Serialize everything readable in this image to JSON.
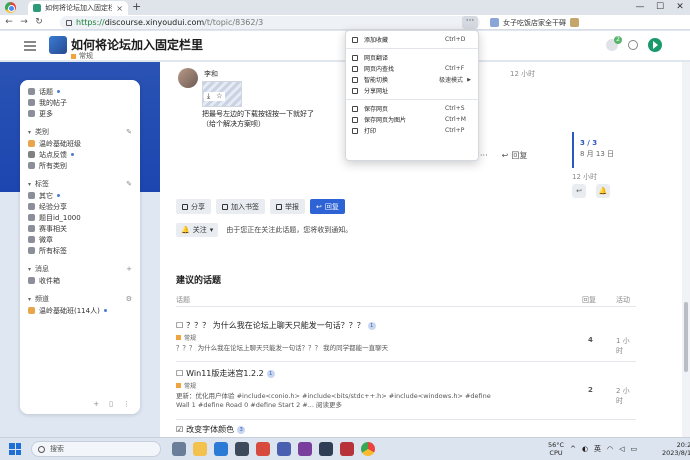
{
  "browser": {
    "tab_title": "如何将论坛加入固定栏里 - 智",
    "tab_close": "×",
    "new_tab": "+",
    "url_scheme": "https://",
    "url_host": "discourse.xinyoudui.com",
    "url_path": "/t/topic/8362/3",
    "more": "···",
    "ext_text": "女子吃饭店家全干碍",
    "win_min": "—",
    "win_max": "☐",
    "win_close": "✕",
    "star": "☆"
  },
  "header": {
    "title": "如何将论坛加入固定栏里",
    "category": "常规",
    "notification_count": "2"
  },
  "sidebar": {
    "top_items": [
      {
        "label": "话题"
      },
      {
        "label": "我的帖子"
      },
      {
        "label": "更多"
      }
    ],
    "categories_label": "类别",
    "categories": [
      {
        "label": "温岭基础班级"
      },
      {
        "label": "站点反馈"
      },
      {
        "label": "所有类别"
      }
    ],
    "tags_label": "标签",
    "tags": [
      {
        "label": "其它"
      },
      {
        "label": "经验分享"
      },
      {
        "label": "题目id_1000"
      },
      {
        "label": "赛事相关"
      },
      {
        "label": "微章"
      },
      {
        "label": "所有标签"
      }
    ],
    "messages_label": "消息",
    "messages": [
      {
        "label": "收件箱"
      }
    ],
    "channels_label": "频道",
    "channels": [
      {
        "label": "温岭基础班(114人)"
      }
    ]
  },
  "post": {
    "author": "李和",
    "time": "12 小时",
    "text_line1": "把最号左边的下载按钮按一下就好了",
    "text_line2": "（给个解决方案呗）",
    "reply_label": "回复",
    "more": "···"
  },
  "timeline": {
    "count": "3 / 3",
    "date": "8 月 13 日",
    "bottom_time": "12 小时"
  },
  "footer": {
    "share": "分享",
    "bookmark": "加入书签",
    "flag": "举报",
    "reply": "回复",
    "notify_label": "关注",
    "notify_text": "由于您正在关注此话题，您将收到通知。"
  },
  "suggested": {
    "title": "建议的话题",
    "col_topic": "话题",
    "col_replies": "回复",
    "col_activity": "活动",
    "rows": [
      {
        "title": "？？？ 为什么我在论坛上聊天只能发一句话？？？",
        "badge": "1",
        "category": "常规",
        "excerpt": "？？？ 为什么我在论坛上聊天只能发一句话？？？ 我的同学都能一直聊天",
        "replies": "4",
        "activity": "1 小时"
      },
      {
        "title": "Win11版走迷宫1.2.2",
        "badge": "1",
        "category": "常规",
        "excerpt": "更新：优化用户体验 #include<conio.h> #include<bits/stdc++.h> #include<windows.h> #define Wall 1 #define Road 0 #define Start 2 #... 阅读更多",
        "replies": "2",
        "activity": "2 小时"
      },
      {
        "title": "改变字体颜色",
        "badge": "3",
        "category": "",
        "excerpt": "",
        "replies": "",
        "activity": ""
      }
    ]
  },
  "context_menu": {
    "items": [
      {
        "label": "添加收藏",
        "shortcut": "Ctrl+D"
      },
      {
        "label": "网页翻译",
        "shortcut": ""
      },
      {
        "label": "网页内查找",
        "shortcut": "Ctrl+F"
      },
      {
        "label": "智能切换",
        "sub": "极速模式"
      },
      {
        "label": "分享网址",
        "shortcut": ""
      },
      {
        "label": "保存网页",
        "shortcut": "Ctrl+S"
      },
      {
        "label": "保存网页为图片",
        "shortcut": "Ctrl+M"
      },
      {
        "label": "打印",
        "shortcut": "Ctrl+P"
      }
    ]
  },
  "taskbar": {
    "search_placeholder": "搜索",
    "weather_temp": "56°C",
    "weather_label": "CPU",
    "ime": "英",
    "time": "20:20",
    "date": "2023/8/13"
  },
  "colors": {
    "accent": "#2e63d6",
    "band": "#2a53b4",
    "category": "#f1a33e"
  }
}
